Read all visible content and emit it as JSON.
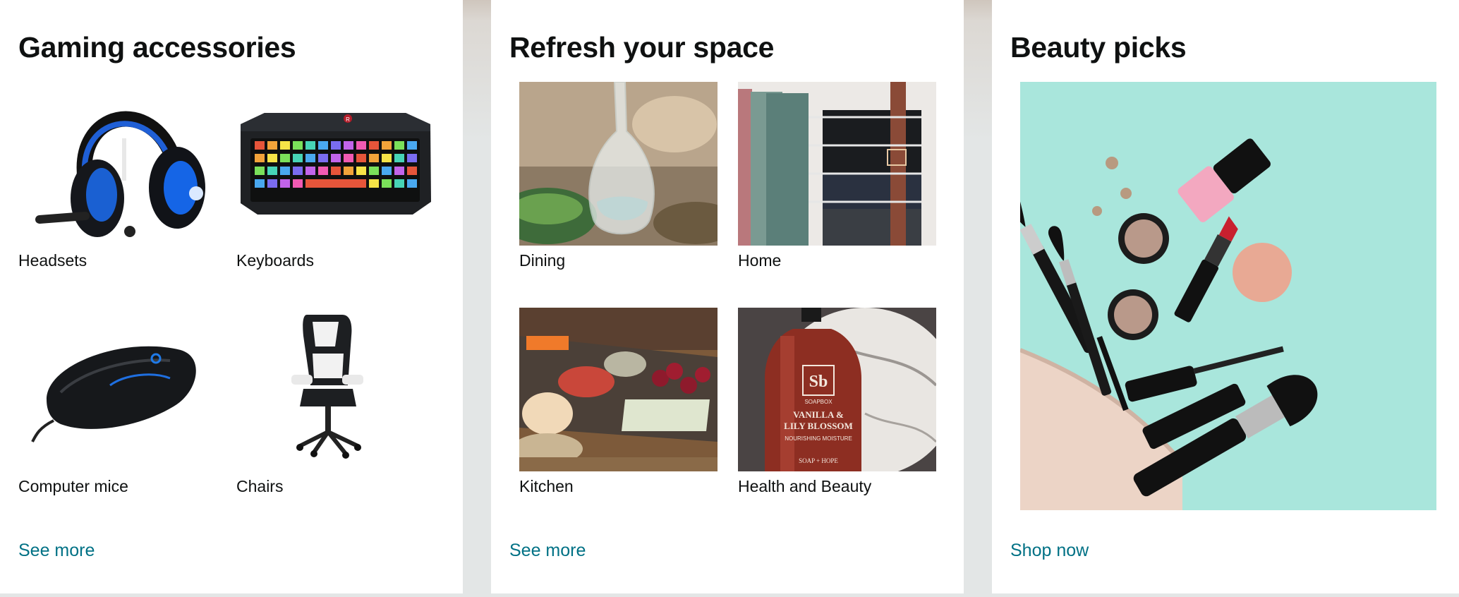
{
  "cards": [
    {
      "title": "Gaming accessories",
      "items": [
        {
          "label": "Headsets",
          "icon": "headset-image"
        },
        {
          "label": "Keyboards",
          "icon": "keyboard-image"
        },
        {
          "label": "Computer mice",
          "icon": "mouse-image"
        },
        {
          "label": "Chairs",
          "icon": "chair-image"
        }
      ],
      "link": "See more"
    },
    {
      "title": "Refresh your space",
      "items": [
        {
          "label": "Dining",
          "icon": "dining-image"
        },
        {
          "label": "Home",
          "icon": "home-image"
        },
        {
          "label": "Kitchen",
          "icon": "kitchen-image"
        },
        {
          "label": "Health and Beauty",
          "icon": "health-beauty-image"
        }
      ],
      "link": "See more"
    },
    {
      "title": "Beauty picks",
      "image": "makeup-image",
      "link": "Shop now"
    }
  ],
  "colors": {
    "link": "#007185",
    "text": "#0f1111",
    "background": "#e3e6e6",
    "card": "#ffffff",
    "beauty_bg": "#a9e6dc"
  },
  "product_labels": {
    "keyboard_badge": "R",
    "bottle_logo": "Sb",
    "bottle_brand": "SOAPBOX",
    "bottle_line1": "VANILLA &",
    "bottle_line2": "LILY BLOSSOM",
    "bottle_line3": "NOURISHING MOISTURE",
    "bottle_footer": "SOAP + HOPE"
  }
}
